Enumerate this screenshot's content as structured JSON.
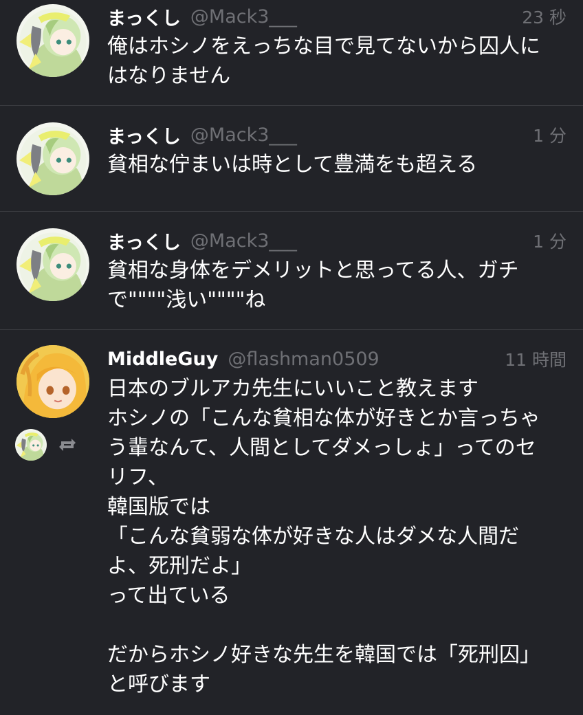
{
  "tweets": [
    {
      "name": "まっくし",
      "handle": "@Mack3___",
      "time": "23 秒",
      "lines": [
        "俺はホシノをえっちな目で見てないから囚人に",
        "はなりません"
      ]
    },
    {
      "name": "まっくし",
      "handle": "@Mack3___",
      "time": "1 分",
      "lines": [
        "貧相な佇まいは時として豊満をも超える"
      ]
    },
    {
      "name": "まっくし",
      "handle": "@Mack3___",
      "time": "1 分",
      "lines": [
        "貧相な身体をデメリットと思ってる人、ガチ",
        "で\"\"\"\"浅い\"\"\"\"ね"
      ]
    },
    {
      "name": "MiddleGuy",
      "handle": "@flashman0509",
      "time": "11 時間",
      "lines": [
        "日本のブルアカ先生にいいこと教えます",
        "ホシノの「こんな貧相な体が好きとか言っちゃ",
        "う輩なんて、人間としてダメっしょ」ってのセ",
        "リフ、",
        "韓国版では",
        "「こんな貧弱な体が好きな人はダメな人間だ",
        "よ、死刑だよ」",
        "って出ている",
        "",
        "だからホシノ好きな先生を韓国では「死刑囚」",
        "と呼びます"
      ]
    }
  ],
  "icons": {
    "avatar_green": "avatar-green-hair-character",
    "avatar_blonde": "avatar-blonde-character",
    "retweet": "retweet-icon"
  },
  "colors": {
    "background": "#222328",
    "text": "#ffffff",
    "secondary": "#6f7075",
    "divider": "#3a3b40"
  }
}
